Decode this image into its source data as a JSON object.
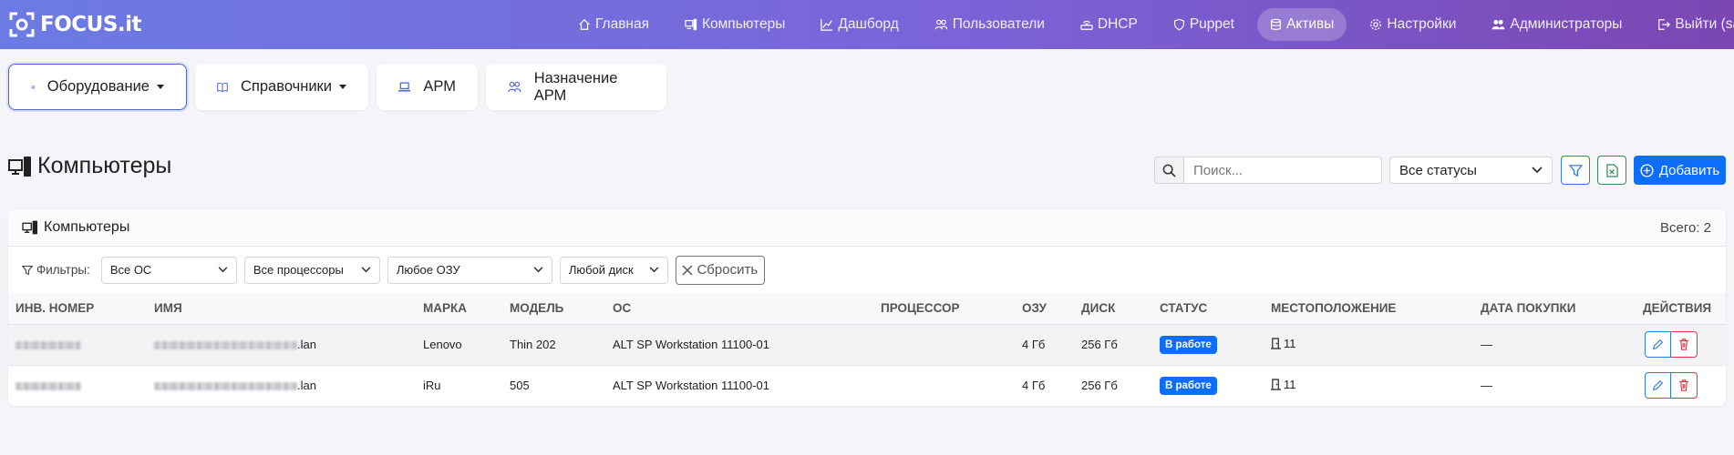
{
  "brand": {
    "name": "FOCUS.it"
  },
  "nav": {
    "items": [
      {
        "label": "Главная",
        "icon": "home-icon"
      },
      {
        "label": "Компьютеры",
        "icon": "pc-icon"
      },
      {
        "label": "Дашборд",
        "icon": "chart-line-icon"
      },
      {
        "label": "Пользователи",
        "icon": "people-icon"
      },
      {
        "label": "DHCP",
        "icon": "router-icon"
      },
      {
        "label": "Puppet",
        "icon": "shield-icon"
      },
      {
        "label": "Активы",
        "icon": "database-icon",
        "active": true
      },
      {
        "label": "Настройки",
        "icon": "gear-icon"
      },
      {
        "label": "Администраторы",
        "icon": "people-fill-icon"
      },
      {
        "label": "Выйти (sanadmin)",
        "icon": "logout-icon"
      }
    ]
  },
  "subtabs": [
    {
      "label": "Оборудование",
      "icon": "pc-display-icon",
      "dropdown": true,
      "active": true
    },
    {
      "label": "Справочники",
      "icon": "book-icon",
      "dropdown": true
    },
    {
      "label": "АРМ",
      "icon": "laptop-icon"
    },
    {
      "label": "Назначение АРМ",
      "icon": "people-icon"
    }
  ],
  "page": {
    "title": "Компьютеры",
    "search_placeholder": "Поиск...",
    "status_filter": "Все статусы",
    "add_label": "Добавить"
  },
  "card": {
    "title": "Компьютеры",
    "total": "Всего: 2",
    "filters_label": "Фильтры:",
    "filters": {
      "os": "Все ОС",
      "cpu": "Все процессоры",
      "ram": "Любое ОЗУ",
      "disk": "Любой диск"
    },
    "reset_label": "Сбросить"
  },
  "table": {
    "headers": {
      "inv": "ИНВ. НОМЕР",
      "name": "ИМЯ",
      "brand": "МАРКА",
      "model": "МОДЕЛЬ",
      "os": "ОС",
      "cpu": "ПРОЦЕССОР",
      "ram": "ОЗУ",
      "disk": "ДИСК",
      "status": "СТАТУС",
      "location": "МЕСТОПОЛОЖЕНИЕ",
      "purchase": "ДАТА ПОКУПКИ",
      "actions": "ДЕЙСТВИЯ"
    },
    "rows": [
      {
        "name_suffix": ".lan",
        "brand": "Lenovo",
        "model": "Thin 202",
        "os": "ALT SP Workstation 11100-01",
        "cpu": "",
        "ram": "4 Гб",
        "disk": "256 Гб",
        "status": "В работе",
        "location": "11",
        "purchase": "—"
      },
      {
        "name_suffix": ".lan",
        "brand": "iRu",
        "model": "505",
        "os": "ALT SP Workstation 11100-01",
        "cpu": "",
        "ram": "4 Гб",
        "disk": "256 Гб",
        "status": "В работе",
        "location": "11",
        "purchase": "—"
      }
    ]
  },
  "colors": {
    "primary": "#0d6efd",
    "navbar_start": "#6c7be3",
    "navbar_end": "#7b46b2",
    "danger": "#dc3545",
    "success": "#2e8b57"
  }
}
